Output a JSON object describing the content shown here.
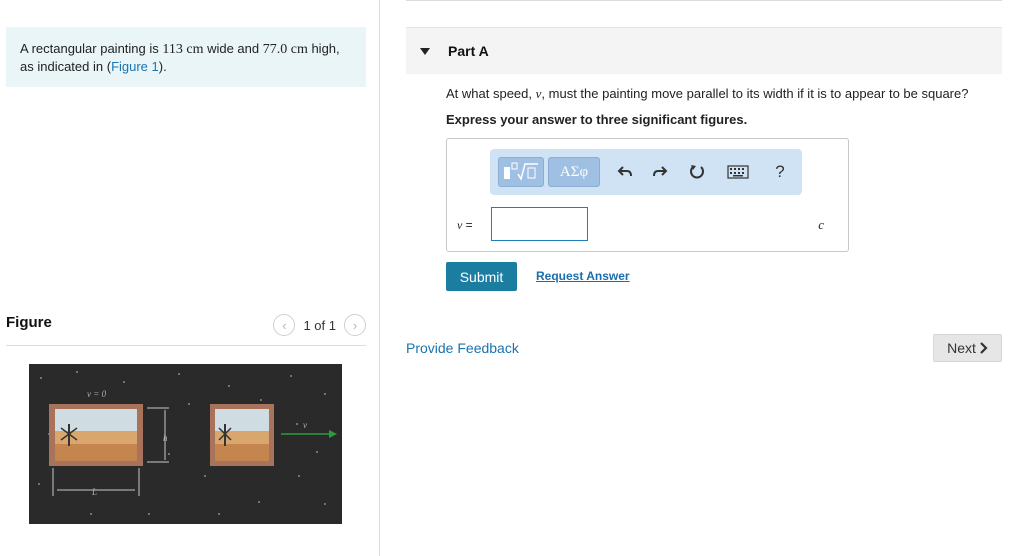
{
  "problem": {
    "text_before": "A rectangular painting is ",
    "width_value": "113 cm",
    "text_middle": " wide and ",
    "height_value": "77.0 cm",
    "text_after": " high, as indicated in (",
    "figure_link": "Figure 1",
    "text_end": ")."
  },
  "figure": {
    "title": "Figure",
    "count": "1 of 1",
    "prev_icon": "chevron-left-icon",
    "next_icon": "chevron-right-icon",
    "labels": {
      "v_zero": "v = 0",
      "h": "h",
      "L": "L",
      "v": "v"
    },
    "colors": {
      "background": "#2a2a2a",
      "frame": "#a8735a",
      "arrow": "#2e9a3e"
    }
  },
  "part": {
    "title": "Part A",
    "question_before": "At what speed, ",
    "question_var": "v",
    "question_after": ", must the painting move parallel to its width if it is to appear to be square?",
    "instruction": "Express your answer to three significant figures.",
    "toolbar": {
      "templates_icon": "templates-icon",
      "symbols_label": "ΑΣφ",
      "undo_icon": "undo-icon",
      "redo_icon": "redo-icon",
      "reset_icon": "reset-icon",
      "keyboard_icon": "keyboard-icon",
      "help_label": "?"
    },
    "var_label": "v",
    "equals": " =",
    "answer_value": "",
    "unit": "c",
    "submit_label": "Submit",
    "request_label": "Request Answer"
  },
  "footer": {
    "feedback_label": "Provide Feedback",
    "next_label": "Next"
  }
}
